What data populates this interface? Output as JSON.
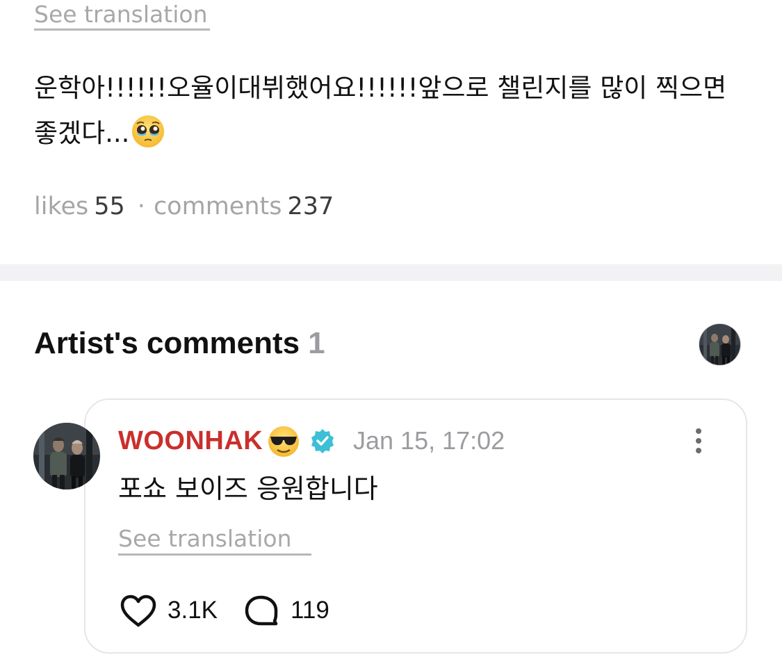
{
  "post": {
    "see_translation": "See translation",
    "body_text": "운학아!!!!!!오율이대뷔했어요!!!!!!앞으로 챌린지를 많이 찍으면 좋겠다...",
    "body_emoji": "pleading-face-emoji",
    "stats": {
      "likes_label": "likes",
      "likes_value": "55",
      "separator": "·",
      "comments_label": "comments",
      "comments_value": "237"
    }
  },
  "artist_comments": {
    "title": "Artist's comments",
    "count": "1",
    "header_avatar": "artist-avatar"
  },
  "comment": {
    "author": "WOONHAK",
    "author_emoji": "sunglasses-emoji",
    "verified": "verified-badge-icon",
    "timestamp": "Jan 15, 17:02",
    "text": "포쇼 보이즈 응원합니다",
    "see_translation": "See translation",
    "likes": "3.1K",
    "replies": "119",
    "more_icon": "more-vertical-icon",
    "heart_icon": "heart-outline-icon",
    "reply_icon": "comment-bubble-icon"
  },
  "colors": {
    "author_name": "#c9302c",
    "muted_text": "#a5a5a9",
    "verified_badge": "#3dbfd6",
    "divider_band": "#f2f2f4",
    "card_border": "#e6e6e9"
  }
}
